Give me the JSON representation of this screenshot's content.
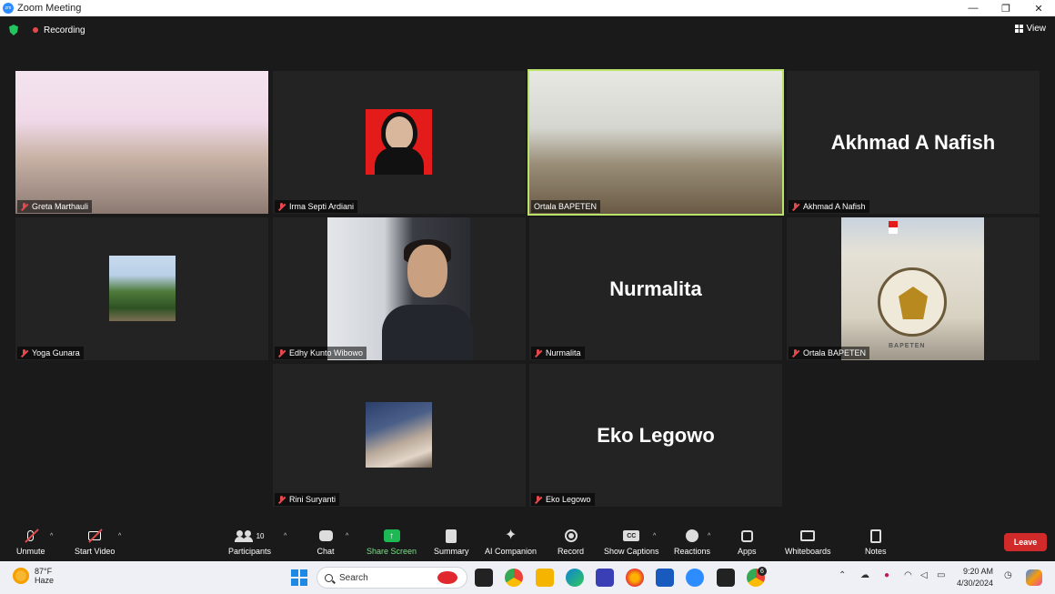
{
  "window": {
    "title": "Zoom Meeting",
    "minimize": "—",
    "restore": "❐",
    "close": "✕"
  },
  "topbar": {
    "recording_label": "Recording",
    "view_label": "View"
  },
  "tiles": {
    "t1": {
      "name": "Greta Marthauli"
    },
    "t2": {
      "name": "Irma Septi Ardiani"
    },
    "t3": {
      "name": "Ortala BAPETEN"
    },
    "t4": {
      "name": "Akhmad A Nafish",
      "display": "Akhmad A Nafish"
    },
    "t5": {
      "name": "Yoga Gunara"
    },
    "t6": {
      "name": "Edhy Kunto Wibowo"
    },
    "t7": {
      "name": "Nurmalita",
      "display": "Nurmalita"
    },
    "t8": {
      "name": "Ortala BAPETEN",
      "logo_text": "BAPETEN"
    },
    "t9": {
      "name": "Rini Suryanti"
    },
    "t10": {
      "name": "Eko Legowo",
      "display": "Eko Legowo"
    }
  },
  "toolbar": {
    "unmute": "Unmute",
    "start_video": "Start Video",
    "participants": "Participants",
    "participants_count": "10",
    "chat": "Chat",
    "share_screen": "Share Screen",
    "summary": "Summary",
    "ai_companion": "AI Companion",
    "record": "Record",
    "show_captions": "Show Captions",
    "cc": "CC",
    "reactions": "Reactions",
    "apps": "Apps",
    "whiteboards": "Whiteboards",
    "notes": "Notes",
    "leave": "Leave"
  },
  "taskbar": {
    "temp": "87°F",
    "weather": "Haze",
    "search_placeholder": "Search",
    "time": "9:20 AM",
    "date": "4/30/2024",
    "chrome_badge": "6"
  },
  "colors": {
    "active_speaker": "#b9e36a",
    "leave": "#d02a2a",
    "share_green": "#1db954",
    "muted_red": "#e5484d"
  }
}
